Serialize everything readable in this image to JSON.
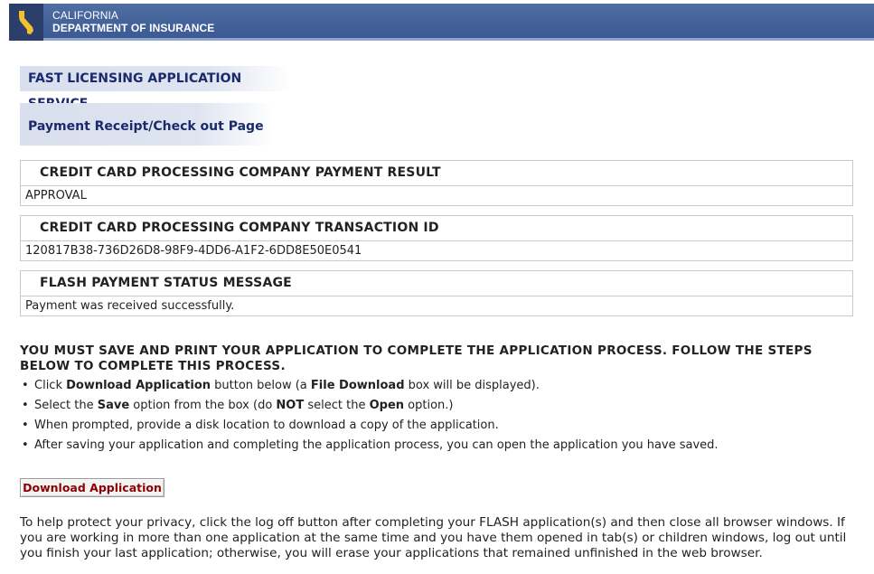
{
  "header": {
    "org_line1": "CALIFORNIA",
    "org_line2": "DEPARTMENT OF INSURANCE",
    "logo_icon": "california-state-icon",
    "colors": {
      "banner": "#4f6ea3",
      "logo_accent": "#f2c12e"
    }
  },
  "page": {
    "service_title": "FAST LICENSING APPLICATION SERVICE",
    "page_title": "Payment Receipt/Check out Page"
  },
  "results": [
    {
      "label": "CREDIT CARD PROCESSING COMPANY PAYMENT RESULT",
      "value": "APPROVAL"
    },
    {
      "label": "CREDIT CARD PROCESSING COMPANY TRANSACTION ID",
      "value": "120817B38-736D26D8-98F9-4DD6-A1F2-6DD8E50E0541"
    },
    {
      "label": "FLASH PAYMENT STATUS MESSAGE",
      "value": "Payment was received successfully."
    }
  ],
  "instructions": {
    "heading": "YOU MUST SAVE AND PRINT YOUR APPLICATION TO COMPLETE THE APPLICATION PROCESS. FOLLOW THE STEPS BELOW TO COMPLETE THIS PROCESS.",
    "steps": [
      {
        "p1": "Click ",
        "b1": "Download Application",
        "p2": " button below (a ",
        "b2": "File Download",
        "p3": " box will be displayed)."
      },
      {
        "p1": "Select the ",
        "b1": "Save",
        "p2": " option from the box (do ",
        "b2": "NOT",
        "p3": " select the ",
        "b3": "Open",
        "p4": " option.)"
      },
      {
        "p1": "When prompted, provide a disk location to download a copy of the application."
      },
      {
        "p1": "After saving your application and completing the application process, you can open the application you have saved."
      }
    ]
  },
  "actions": {
    "download_label": "Download Application"
  },
  "privacy_note": "To help protect your privacy, click the log off button after completing your FLASH application(s) and then close all browser windows. If you are working in more than one application at the same time and you have them opened in tab(s) or children windows, log out until you finish your last application; otherwise, you will erase your applications that remained unfinished in the web browser."
}
